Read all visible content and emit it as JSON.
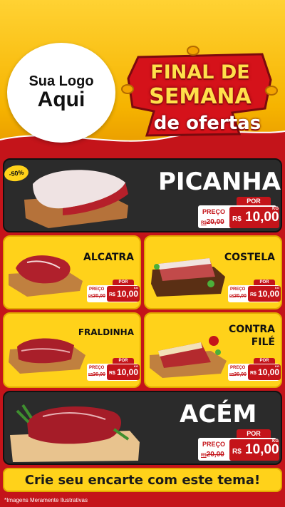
{
  "logo": {
    "line1": "Sua Logo",
    "line2": "Aqui"
  },
  "promo": {
    "line1": "FINAL DE",
    "line2": "SEMANA",
    "line3": "de ofertas"
  },
  "discount_badge": "-50%",
  "products": [
    {
      "name": "PICANHA",
      "por": "POR",
      "preco": "PREÇO",
      "old_prefix": "R$",
      "old_price": "20,00",
      "currency": "R$",
      "price": "10,00",
      "unit": "KG"
    },
    {
      "name": "ALCATRA",
      "por": "POR",
      "preco": "PREÇO",
      "old_prefix": "R$",
      "old_price": "20,00",
      "currency": "R$",
      "price": "10,00",
      "unit": "KG"
    },
    {
      "name": "COSTELA",
      "por": "POR",
      "preco": "PREÇO",
      "old_prefix": "R$",
      "old_price": "20,00",
      "currency": "R$",
      "price": "10,00",
      "unit": "KG"
    },
    {
      "name": "FRALDINHA",
      "por": "POR",
      "preco": "PREÇO",
      "old_prefix": "R$",
      "old_price": "20,00",
      "currency": "R$",
      "price": "10,00",
      "unit": "KG"
    },
    {
      "name_line1": "CONTRA",
      "name_line2": "FILÉ",
      "por": "POR",
      "preco": "PREÇO",
      "old_prefix": "R$",
      "old_price": "20,00",
      "currency": "R$",
      "price": "10,00",
      "unit": "KG"
    },
    {
      "name": "ACÉM",
      "por": "POR",
      "preco": "PREÇO",
      "old_prefix": "R$",
      "old_price": "20,00",
      "currency": "R$",
      "price": "10,00",
      "unit": "KG"
    }
  ],
  "footer": {
    "cta": "Crie seu encarte com este tema!",
    "note": "*Imagens Meramente Ilustrativas"
  },
  "colors": {
    "red": "#c4141a",
    "yellow": "#ffd21a",
    "dark": "#2b2b2b",
    "white": "#ffffff"
  }
}
